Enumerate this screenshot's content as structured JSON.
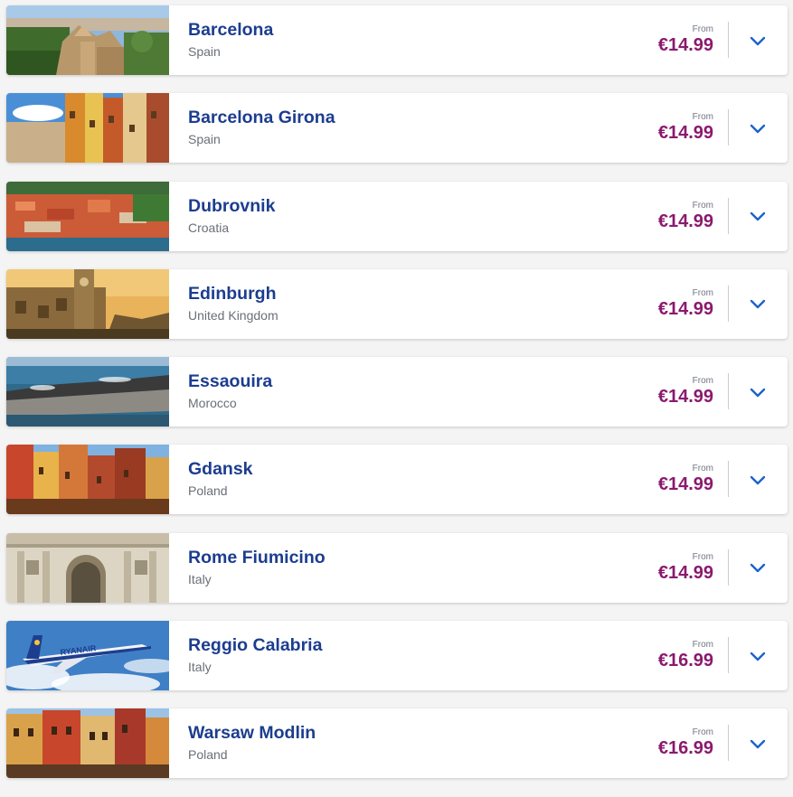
{
  "destinations": [
    {
      "city": "Barcelona",
      "country": "Spain",
      "from_label": "From",
      "price": "€14.99",
      "image": "barcelona-photo"
    },
    {
      "city": "Barcelona Girona",
      "country": "Spain",
      "from_label": "From",
      "price": "€14.99",
      "image": "girona-photo"
    },
    {
      "city": "Dubrovnik",
      "country": "Croatia",
      "from_label": "From",
      "price": "€14.99",
      "image": "dubrovnik-photo"
    },
    {
      "city": "Edinburgh",
      "country": "United Kingdom",
      "from_label": "From",
      "price": "€14.99",
      "image": "edinburgh-photo"
    },
    {
      "city": "Essaouira",
      "country": "Morocco",
      "from_label": "From",
      "price": "€14.99",
      "image": "essaouira-photo"
    },
    {
      "city": "Gdansk",
      "country": "Poland",
      "from_label": "From",
      "price": "€14.99",
      "image": "gdansk-photo"
    },
    {
      "city": "Rome Fiumicino",
      "country": "Italy",
      "from_label": "From",
      "price": "€14.99",
      "image": "rome-photo"
    },
    {
      "city": "Reggio Calabria",
      "country": "Italy",
      "from_label": "From",
      "price": "€16.99",
      "image": "ryanair-plane-photo"
    },
    {
      "city": "Warsaw Modlin",
      "country": "Poland",
      "from_label": "From",
      "price": "€16.99",
      "image": "warsaw-photo"
    }
  ],
  "plane_livery_text": "RYANAIR",
  "colors": {
    "city_text": "#1c3d8f",
    "price_text": "#8a1a6e",
    "chevron": "#1c63c9",
    "page_background": "#f4f4f4"
  },
  "icons": {
    "expand": "chevron-down-icon"
  }
}
